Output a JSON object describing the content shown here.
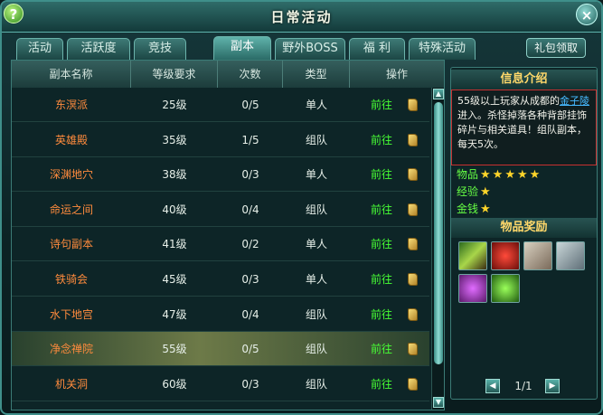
{
  "window": {
    "title": "日常活动"
  },
  "tabs": [
    {
      "label": "活动",
      "active": false
    },
    {
      "label": "活跃度",
      "active": false
    },
    {
      "label": "竞技",
      "active": false
    },
    {
      "label": "副本",
      "active": true
    },
    {
      "label": "野外BOSS",
      "active": false
    },
    {
      "label": "福 利",
      "active": false
    },
    {
      "label": "特殊活动",
      "active": false
    }
  ],
  "gift_button": "礼包领取",
  "table": {
    "headers": [
      "副本名称",
      "等级要求",
      "次数",
      "类型",
      "操作"
    ],
    "rows": [
      {
        "name": "东溟派",
        "level": "25级",
        "count": "0/5",
        "type": "单人",
        "action": "前往"
      },
      {
        "name": "英雄殿",
        "level": "35级",
        "count": "1/5",
        "type": "组队",
        "action": "前往"
      },
      {
        "name": "深渊地穴",
        "level": "38级",
        "count": "0/3",
        "type": "单人",
        "action": "前往"
      },
      {
        "name": "命运之间",
        "level": "40级",
        "count": "0/4",
        "type": "组队",
        "action": "前往"
      },
      {
        "name": "诗句副本",
        "level": "41级",
        "count": "0/2",
        "type": "单人",
        "action": "前往"
      },
      {
        "name": "铁骑会",
        "level": "45级",
        "count": "0/3",
        "type": "单人",
        "action": "前往"
      },
      {
        "name": "水下地宫",
        "level": "47级",
        "count": "0/4",
        "type": "组队",
        "action": "前往"
      },
      {
        "name": "净念禅院",
        "level": "55级",
        "count": "0/5",
        "type": "组队",
        "action": "前往",
        "selected": true
      },
      {
        "name": "机关洞",
        "level": "60级",
        "count": "0/3",
        "type": "组队",
        "action": "前往"
      }
    ]
  },
  "info": {
    "title": "信息介绍",
    "text_before": "55级以上玩家从成都的",
    "link": "金子陵",
    "text_after": "进入。杀怪掉落各种背部挂饰碎片与相关道具！组队副本，每天5次。",
    "ratings": [
      {
        "label": "物品",
        "stars": 5
      },
      {
        "label": "经验",
        "stars": 1
      },
      {
        "label": "金钱",
        "stars": 1
      }
    ]
  },
  "rewards": {
    "title": "物品奖励",
    "items": [
      "green-ingot-item",
      "red-crystal-item",
      "gray-scroll-item",
      "silver-box-item",
      "purple-orb-item",
      "green-gem-item"
    ],
    "page": "1/1"
  },
  "colors": {
    "accent": "#3f8f8a",
    "name": "#ff8b3d",
    "go": "#47ff34",
    "title_gold": "#ffd86a",
    "star": "#ffd52a"
  }
}
